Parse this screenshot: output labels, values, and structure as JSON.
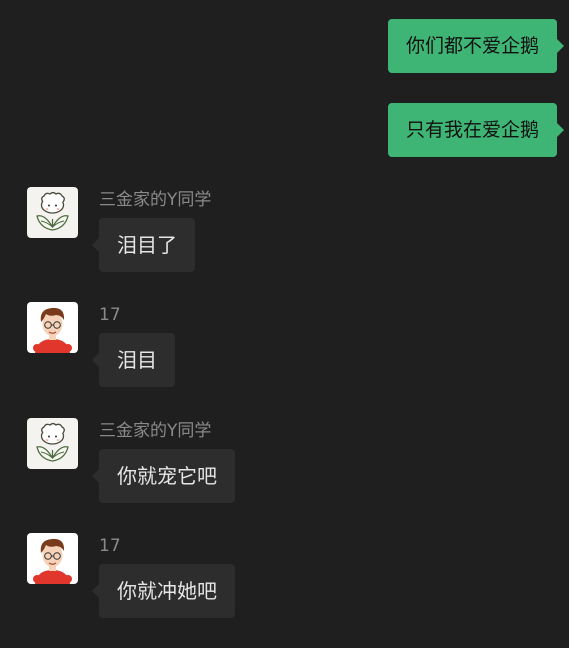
{
  "colors": {
    "background": "#1f1f1f",
    "outgoing_bubble": "#3eb575",
    "incoming_bubble": "#2d2d2d",
    "sender_name": "#8a8a8a"
  },
  "messages": [
    {
      "direction": "out",
      "text": "你们都不爱企鹅"
    },
    {
      "direction": "out",
      "text": "只有我在爱企鹅"
    },
    {
      "direction": "in",
      "sender": "三金家的Y同学",
      "avatar": "sheep-avatar-icon",
      "text": "泪目了"
    },
    {
      "direction": "in",
      "sender": "17",
      "avatar": "boy-avatar-icon",
      "text": "泪目"
    },
    {
      "direction": "in",
      "sender": "三金家的Y同学",
      "avatar": "sheep-avatar-icon",
      "text": "你就宠它吧"
    },
    {
      "direction": "in",
      "sender": "17",
      "avatar": "boy-avatar-icon",
      "text": "你就冲她吧"
    }
  ]
}
